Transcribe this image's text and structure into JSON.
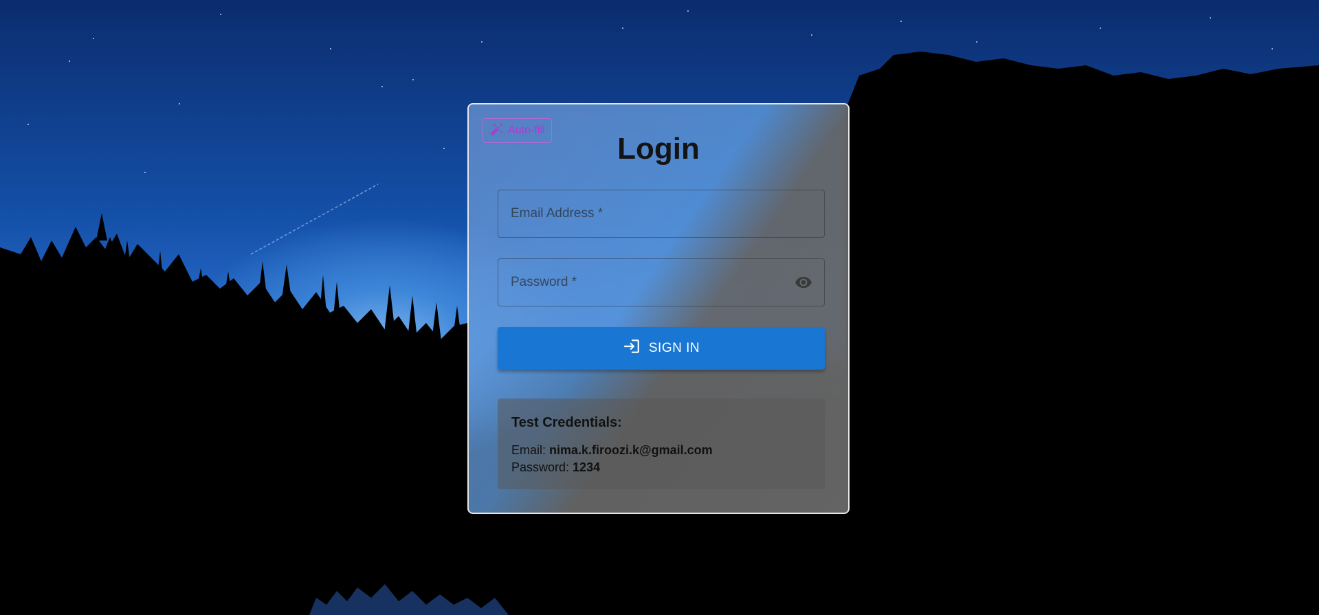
{
  "autofill": {
    "label": "Auto-fill",
    "icon": "magic-wand-icon",
    "color": "#b03ad0"
  },
  "login": {
    "title": "Login"
  },
  "email_field": {
    "placeholder": "Email Address *",
    "value": ""
  },
  "password_field": {
    "placeholder": "Password *",
    "value": "",
    "icon": "eye-icon"
  },
  "signin_button": {
    "label": "SIGN IN",
    "icon": "login-icon",
    "color": "#1976d2"
  },
  "credentials": {
    "heading": "Test Credentials:",
    "email_label": "Email:",
    "email_value": "nima.k.firoozi.k@gmail.com",
    "password_label": "Password:",
    "password_value": "1234"
  }
}
